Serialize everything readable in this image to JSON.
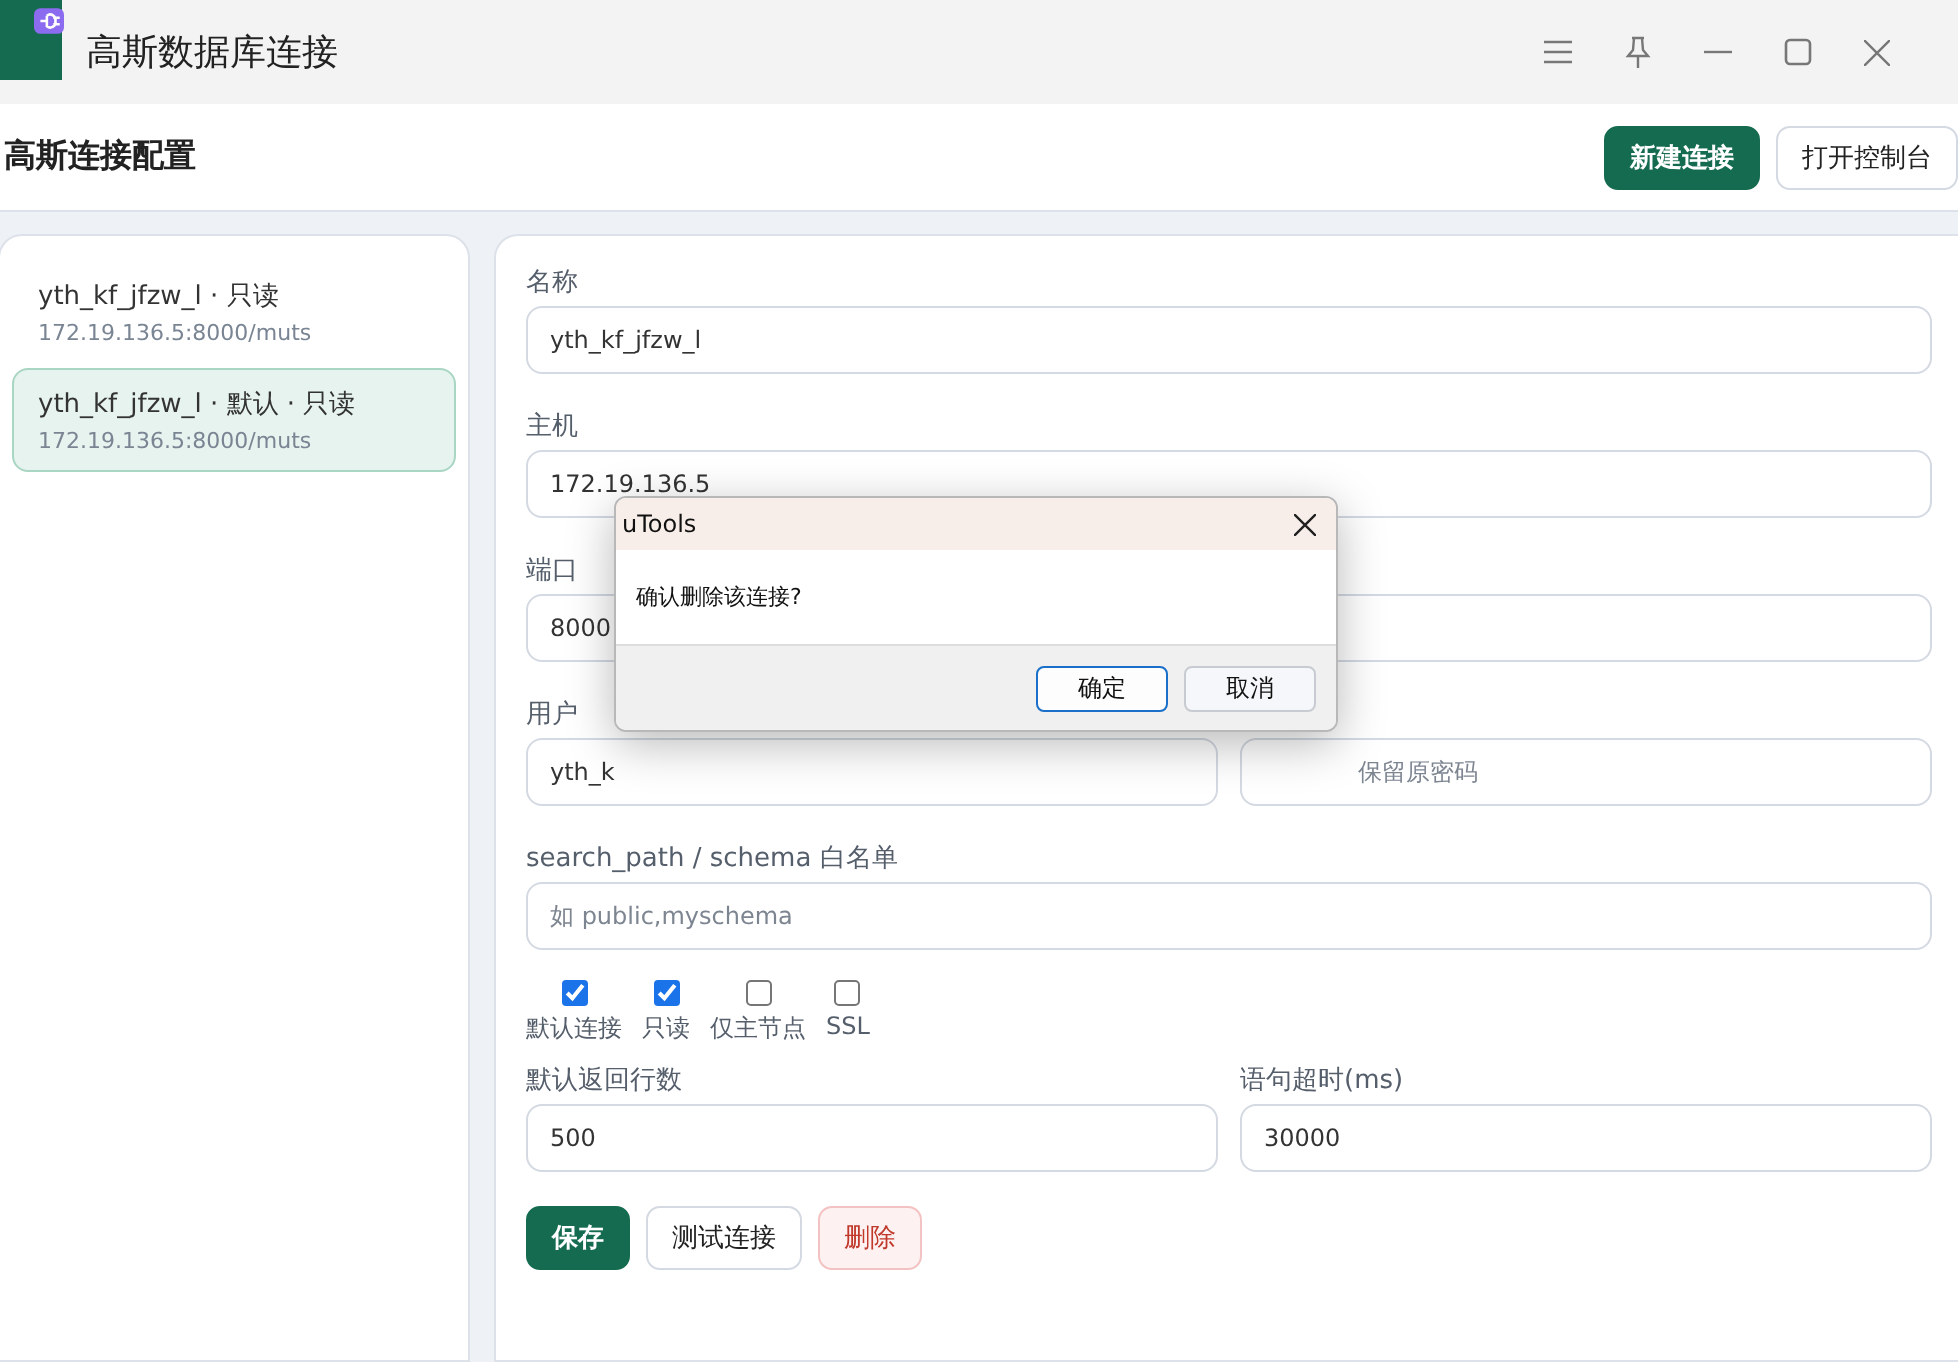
{
  "window": {
    "title": "高斯数据库连接"
  },
  "header": {
    "title": "高斯连接配置",
    "buttons": [
      {
        "label": "新建连接",
        "kind": "primary"
      },
      {
        "label": "打开控制台",
        "kind": "default"
      }
    ]
  },
  "connections": [
    {
      "name": "yth_kf_jfzw_l · 只读",
      "address": "172.19.136.5:8000/muts",
      "selected": false
    },
    {
      "name": "yth_kf_jfzw_l · 默认 · 只读",
      "address": "172.19.136.5:8000/muts",
      "selected": true
    }
  ],
  "form": {
    "name": {
      "label": "名称",
      "value": "yth_kf_jfzw_l"
    },
    "host": {
      "label": "主机",
      "value": "172.19.136.5"
    },
    "port": {
      "label": "端口",
      "value": "8000"
    },
    "user": {
      "label": "用户",
      "value": "yth_k"
    },
    "password": {
      "placeholder": "保留原密码"
    },
    "schema": {
      "label": "search_path / schema 白名单",
      "placeholder": "如 public,myschema"
    },
    "options": [
      {
        "label": "默认连接",
        "checked": true
      },
      {
        "label": "只读",
        "checked": true
      },
      {
        "label": "仅主节点",
        "checked": false
      },
      {
        "label": "SSL",
        "checked": false
      }
    ],
    "rows": {
      "label": "默认返回行数",
      "value": "500"
    },
    "timeout": {
      "label": "语句超时(ms)",
      "value": "30000"
    },
    "actions": [
      {
        "label": "保存",
        "kind": "primary"
      },
      {
        "label": "测试连接",
        "kind": "default"
      },
      {
        "label": "删除",
        "kind": "danger"
      }
    ]
  },
  "dialog": {
    "title": "uTools",
    "message": "确认删除该连接?",
    "buttons": [
      {
        "label": "确定",
        "kind": "default"
      },
      {
        "label": "取消",
        "kind": "secondary"
      }
    ]
  }
}
